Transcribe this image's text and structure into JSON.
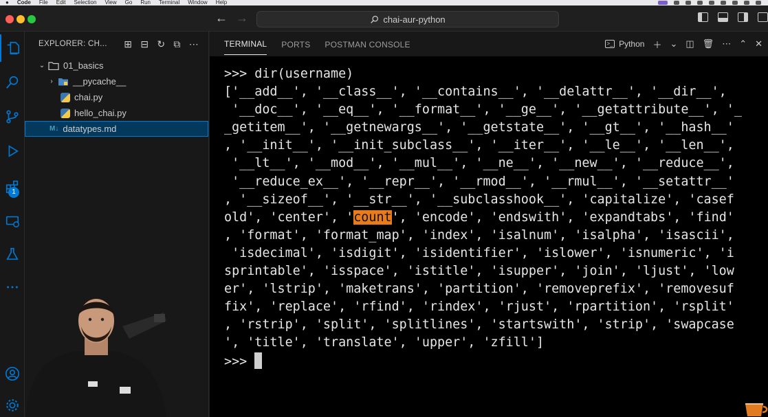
{
  "menubar": {
    "app": "Code",
    "items": [
      "File",
      "Edit",
      "Selection",
      "View",
      "Go",
      "Run",
      "Terminal",
      "Window",
      "Help"
    ]
  },
  "titlebar": {
    "search_text": "chai-aur-python",
    "search_icon": "search-icon",
    "back_icon": "arrow-left-icon",
    "forward_icon": "arrow-right-icon"
  },
  "activity_bar": {
    "items": [
      "files-icon",
      "search-icon",
      "source-control-icon",
      "run-debug-icon",
      "extensions-icon",
      "remote-explorer-icon",
      "testing-icon",
      "more-icon",
      "account-icon",
      "manage-gear-icon"
    ],
    "extensions_badge": "1"
  },
  "explorer": {
    "title": "EXPLORER: CH...",
    "tree": [
      {
        "label": "01_basics",
        "type": "folder",
        "expanded": true
      },
      {
        "label": "__pycache__",
        "type": "folder",
        "expanded": false
      },
      {
        "label": "chai.py",
        "type": "python"
      },
      {
        "label": "hello_chai.py",
        "type": "python"
      },
      {
        "label": "datatypes.md",
        "type": "markdown",
        "selected": true
      }
    ],
    "md_badge": "M↓"
  },
  "panel": {
    "tabs": [
      "TERMINAL",
      "PORTS",
      "POSTMAN CONSOLE"
    ],
    "active_tab": "TERMINAL",
    "terminal_type": "Python"
  },
  "terminal": {
    "command_line": ">>> dir(username)",
    "output_lines": [
      "['__add__', '__class__', '__contains__', '__delattr__', '__dir__',",
      " '__doc__', '__eq__', '__format__', '__ge__', '__getattribute__', '_",
      "_getitem__', '__getnewargs__', '__getstate__', '__gt__', '__hash__'",
      ", '__init__', '__init_subclass__', '__iter__', '__le__', '__len__',",
      " '__lt__', '__mod__', '__mul__', '__ne__', '__new__', '__reduce__',",
      " '__reduce_ex__', '__repr__', '__rmod__', '__rmul__', '__setattr__'",
      ", '__sizeof__', '__str__', '__subclasshook__', 'capitalize', 'casef",
      "old', 'center', '",
      "', 'encode', 'endswith', 'expandtabs', 'find'",
      ", 'format', 'format_map', 'index', 'isalnum', 'isalpha', 'isascii',",
      " 'isdecimal', 'isdigit', 'isidentifier', 'islower', 'isnumeric', 'i",
      "sprintable', 'isspace', 'istitle', 'isupper', 'join', 'ljust', 'low",
      "er', 'lstrip', 'maketrans', 'partition', 'removeprefix', 'removesuf",
      "fix', 'replace', 'rfind', 'rindex', 'rjust', 'rpartition', 'rsplit'",
      ", 'rstrip', 'split', 'splitlines', 'startswith', 'strip', 'swapcase",
      "', 'title', 'translate', 'upper', 'zfill']"
    ],
    "highlighted_word": "count",
    "prompt": ">>> "
  },
  "colors": {
    "accent": "#0078d4",
    "highlight": "#e87b1c",
    "terminal_bg": "#000000"
  }
}
